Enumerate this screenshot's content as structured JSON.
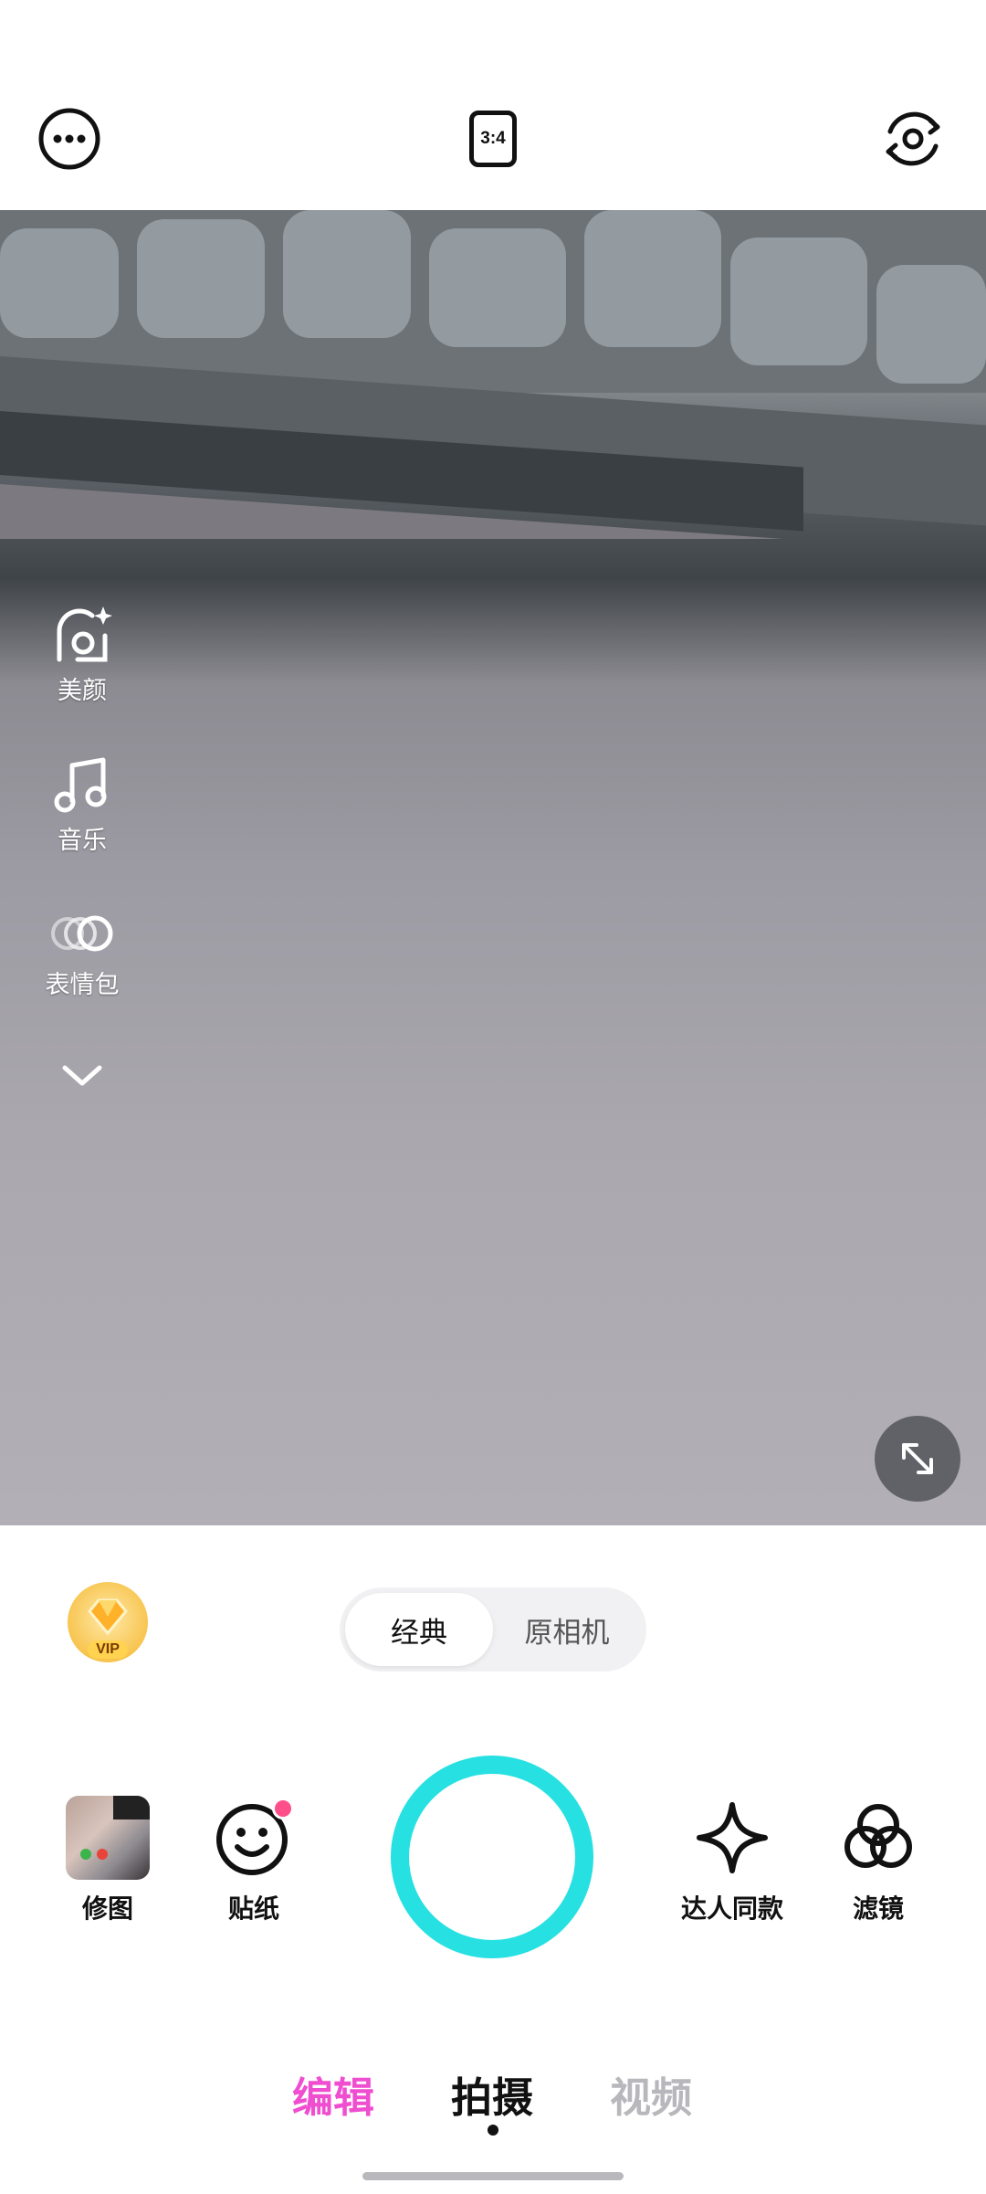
{
  "top_bar": {
    "more_icon": "more-icon",
    "aspect_ratio": "3:4",
    "flip_camera_icon": "flip-camera-icon"
  },
  "side_tools": [
    {
      "icon": "beauty-icon",
      "label": "美颜"
    },
    {
      "icon": "music-icon",
      "label": "音乐"
    },
    {
      "icon": "emoji-pack-icon",
      "label": "表情包"
    }
  ],
  "mode_toggle": {
    "options": [
      "经典",
      "原相机"
    ],
    "selected": "经典"
  },
  "vip_badge": {
    "text": "VIP"
  },
  "tools": {
    "retouch": "修图",
    "stickers": "贴纸",
    "influencer_same": "达人同款",
    "filters": "滤镜"
  },
  "bottom_tabs": [
    {
      "label": "编辑",
      "color": "#f04ed0"
    },
    {
      "label": "拍摄",
      "color": "#111111"
    },
    {
      "label": "视频",
      "color": "#b8b8bc"
    }
  ],
  "colors": {
    "shutter_ring": "#27e0e2",
    "notification_dot": "#ff4f8b"
  }
}
